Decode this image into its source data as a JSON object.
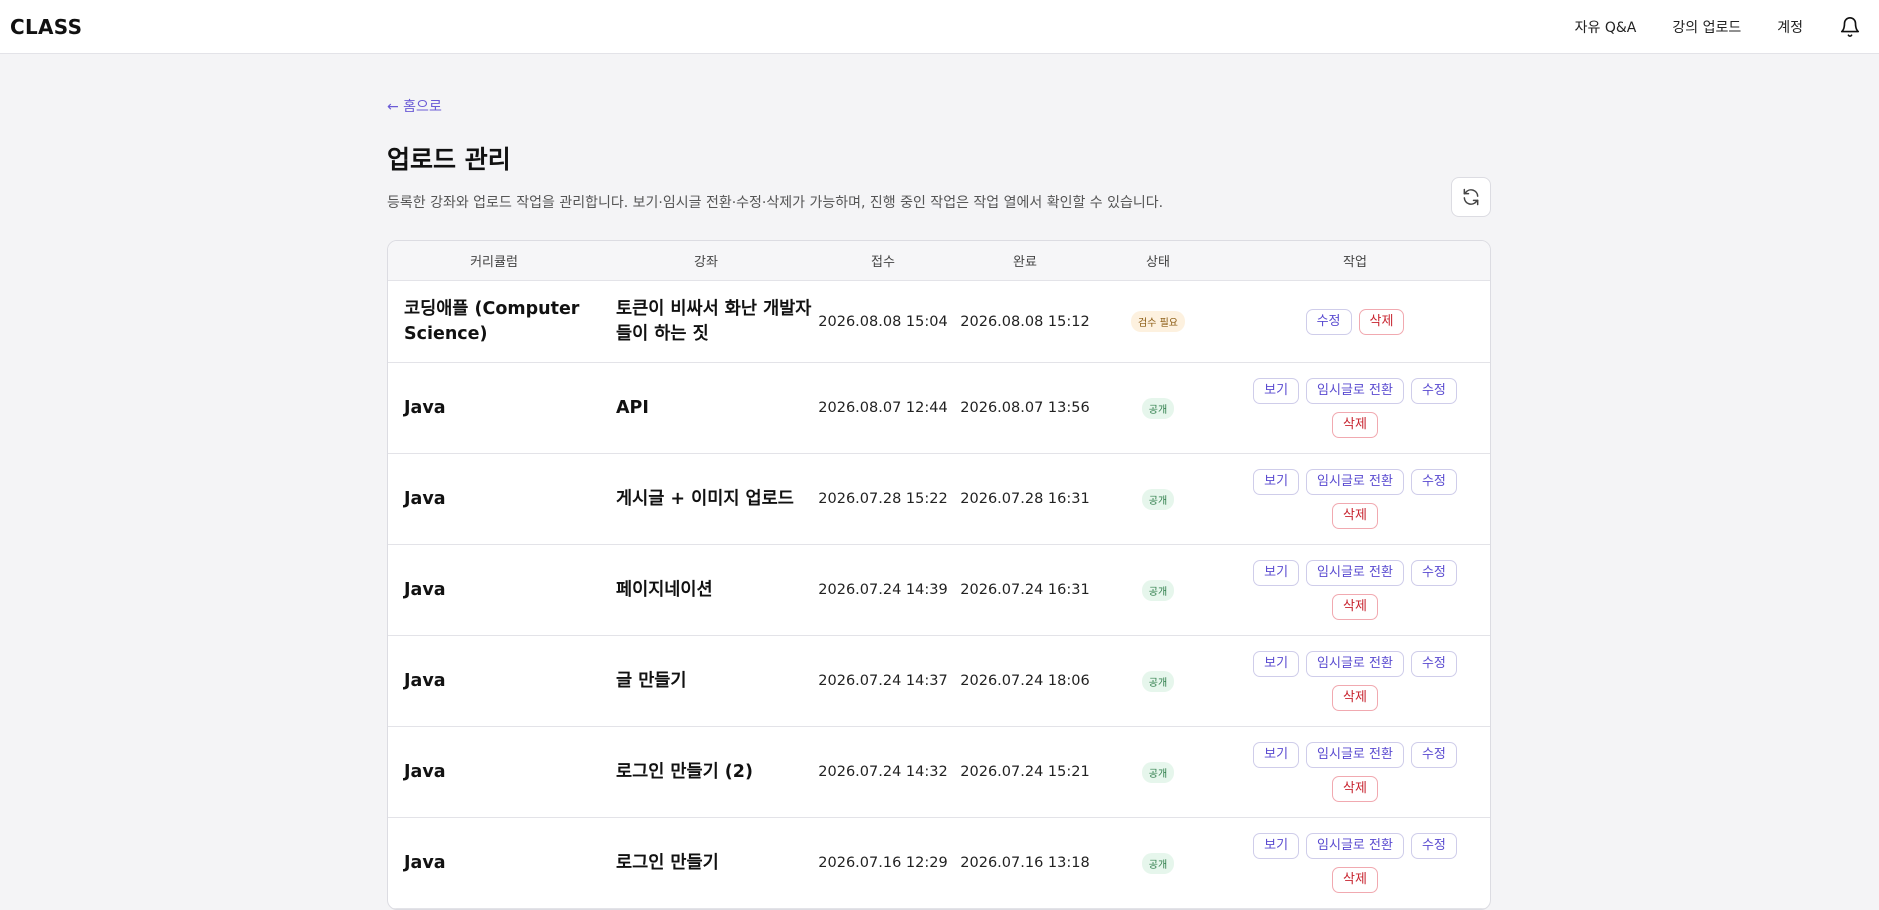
{
  "app": {
    "brand": "CLASS"
  },
  "nav": {
    "qna": "자유 Q&A",
    "upload": "강의 업로드",
    "account": "계정",
    "bell_icon": "bell-icon"
  },
  "page": {
    "back": "← 홈으로",
    "title": "업로드 관리",
    "description": "등록한 강좌와 업로드 작업을 관리합니다. 보기·임시글 전환·수정·삭제가 가능하며, 진행 중인 작업은 작업 열에서 확인할 수 있습니다.",
    "refresh_icon": "refresh-icon"
  },
  "table": {
    "headers": {
      "curriculum": "커리큘럼",
      "course": "강좌",
      "received": "접수",
      "completed": "완료",
      "status": "상태",
      "actions": "작업"
    },
    "action_labels": {
      "view": "보기",
      "draft": "임시글로 전환",
      "edit": "수정",
      "delete": "삭제"
    },
    "rows": [
      {
        "curriculum": "코딩애플 (Computer Science)",
        "course": "토큰이 비싸서 화난 개발자들이 하는 짓",
        "received": "2026.08.08 15:04",
        "completed": "2026.08.08 15:12",
        "status": "검수 필요"
      },
      {
        "curriculum": "Java",
        "course": "API",
        "received": "2026.08.07 12:44",
        "completed": "2026.08.07 13:56",
        "status": "공개"
      },
      {
        "curriculum": "Java",
        "course": "게시글 + 이미지 업로드",
        "received": "2026.07.28 15:22",
        "completed": "2026.07.28 16:31",
        "status": "공개"
      },
      {
        "curriculum": "Java",
        "course": "페이지네이션",
        "received": "2026.07.24 14:39",
        "completed": "2026.07.24 16:31",
        "status": "공개"
      },
      {
        "curriculum": "Java",
        "course": "글 만들기",
        "received": "2026.07.24 14:37",
        "completed": "2026.07.24 18:06",
        "status": "공개"
      },
      {
        "curriculum": "Java",
        "course": "로그인 만들기 (2)",
        "received": "2026.07.24 14:32",
        "completed": "2026.07.24 15:21",
        "status": "공개"
      },
      {
        "curriculum": "Java",
        "course": "로그인 만들기",
        "received": "2026.07.16 12:29",
        "completed": "2026.07.16 13:18",
        "status": "공개"
      }
    ]
  },
  "colors": {
    "accent": "#5a4bd0",
    "danger": "#c8242f",
    "public_badge": "#2e7d4a",
    "review_badge": "#8a5a10"
  }
}
